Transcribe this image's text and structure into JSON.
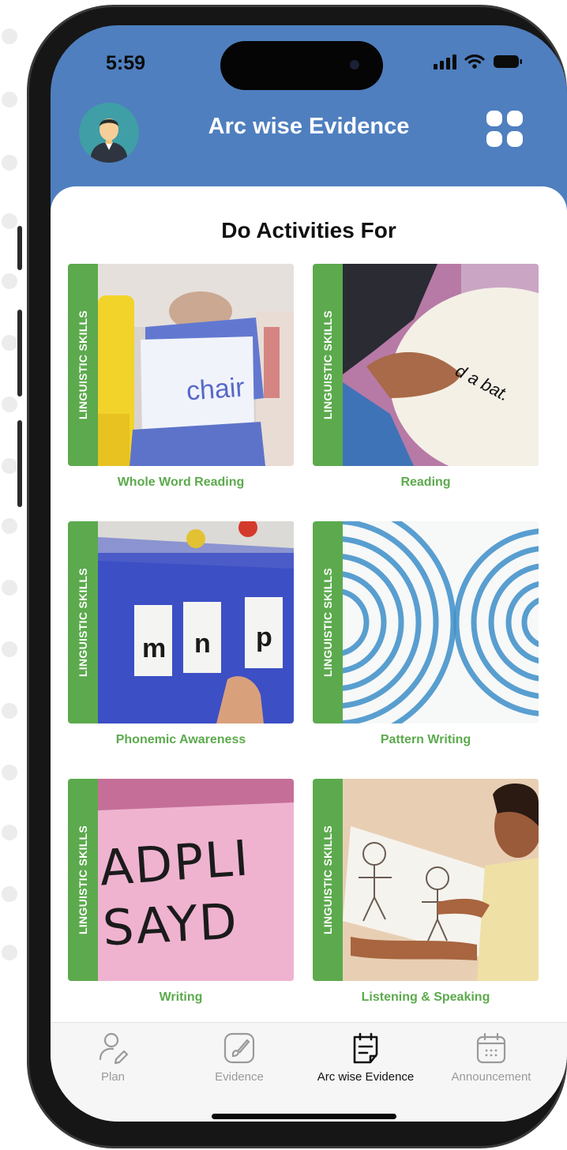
{
  "status_bar": {
    "time": "5:59"
  },
  "header": {
    "title": "Arc wise Evidence",
    "avatar_icon": "user-avatar-icon",
    "menu_icon": "grid-menu-icon"
  },
  "section": {
    "title": "Do Activities For"
  },
  "activities": [
    {
      "category": "LINGUISTIC SKILLS",
      "label": "Whole Word Reading",
      "photo_text": "chair"
    },
    {
      "category": "LINGUISTIC SKILLS",
      "label": "Reading",
      "photo_text": "d a bat."
    },
    {
      "category": "LINGUISTIC SKILLS",
      "label": "Phonemic Awareness",
      "photo_text": [
        "m",
        "n",
        "p"
      ]
    },
    {
      "category": "LINGUISTIC SKILLS",
      "label": "Pattern Writing"
    },
    {
      "category": "LINGUISTIC SKILLS",
      "label": "Writing",
      "photo_text": [
        "ADPLI",
        "SAYD"
      ]
    },
    {
      "category": "LINGUISTIC SKILLS",
      "label": "Listening & Speaking"
    }
  ],
  "bottom_nav": [
    {
      "label": "Plan",
      "icon": "person-edit-icon",
      "active": false
    },
    {
      "label": "Evidence",
      "icon": "brush-icon",
      "active": false
    },
    {
      "label": "Arc wise Evidence",
      "icon": "notes-icon",
      "active": true
    },
    {
      "label": "Announcement",
      "icon": "calendar-icon",
      "active": false
    }
  ],
  "colors": {
    "header_blue": "#4f7fbf",
    "accent_green": "#5caa4d"
  }
}
